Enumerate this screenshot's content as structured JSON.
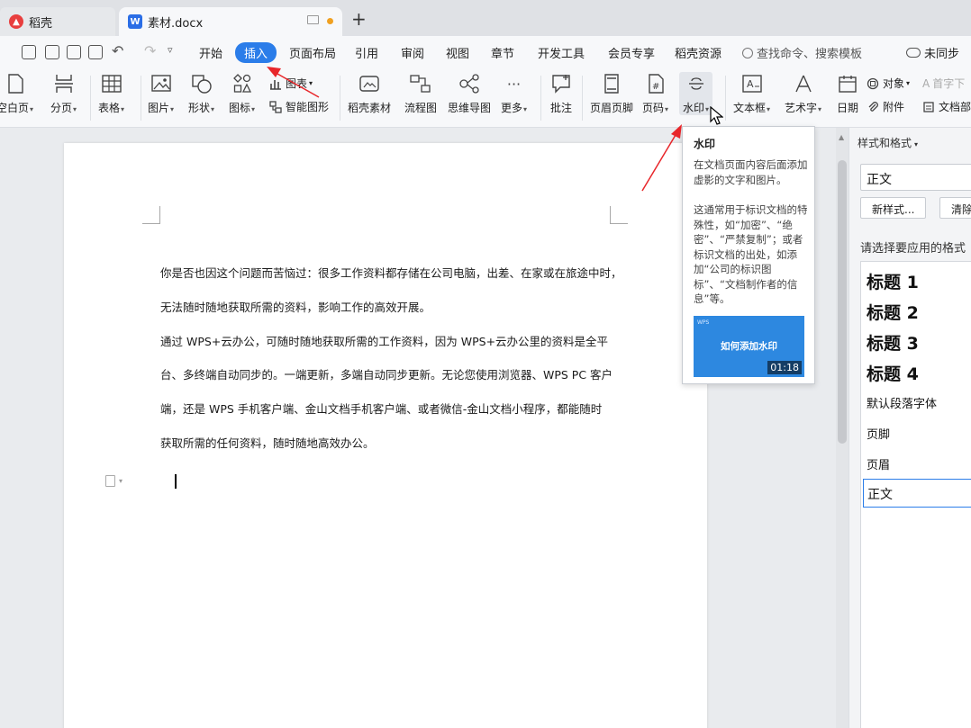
{
  "tabs": [
    {
      "label": "稻壳"
    },
    {
      "label": "素材.docx"
    }
  ],
  "menu": {
    "items": [
      "开始",
      "插入",
      "页面布局",
      "引用",
      "审阅",
      "视图",
      "章节",
      "开发工具",
      "会员专享",
      "稻壳资源"
    ],
    "search": "查找命令、搜索模板",
    "sync": "未同步"
  },
  "ribbon": {
    "blank_page": "空白页",
    "page_break": "分页",
    "table": "表格",
    "picture": "图片",
    "shape": "形状",
    "icon": "图标",
    "chart": "图表",
    "smart_graphic": "智能图形",
    "daoke_material": "稻壳素材",
    "flowchart": "流程图",
    "mindmap": "思维导图",
    "more": "更多",
    "comment": "批注",
    "header_footer": "页眉页脚",
    "page_number": "页码",
    "watermark": "水印",
    "textbox": "文本框",
    "wordart": "艺术字",
    "date": "日期",
    "object": "对象",
    "attachment": "附件",
    "dropcap": "首字下",
    "docpart": "文档部"
  },
  "document": {
    "paragraphs": [
      "你是否也因这个问题而苦恼过：很多工作资料都存储在公司电脑，出差、在家或在旅途中时，",
      "无法随时随地获取所需的资料，影响工作的高效开展。",
      "通过 WPS+云办公，可随时随地获取所需的工作资料，因为 WPS+云办公里的资料是全平",
      "台、多终端自动同步的。一端更新，多端自动同步更新。无论您使用浏览器、WPS PC 客户",
      "端，还是 WPS 手机客户端、金山文档手机客户端、或者微信-金山文档小程序，都能随时",
      "获取所需的任何资料，随时随地高效办公。"
    ]
  },
  "tooltip": {
    "title": "水印",
    "line1": "在文档页面内容后面添加虚影的文字和图片。",
    "line2": "这通常用于标识文档的特殊性，如“加密”、“绝密”、“严禁复制”；或者标识文档的出处，如添加“公司的标识图标”、“文档制作者的信息”等。",
    "video_title": "如何添加水印",
    "video_duration": "01:18"
  },
  "right_pane": {
    "title": "样式和格式",
    "current_style": "正文",
    "new_style_button": "新样式...",
    "clear_button": "清除",
    "choose_label": "请选择要应用的格式",
    "styles": [
      "标题 1",
      "标题 2",
      "标题 3",
      "标题 4",
      "默认段落字体",
      "页脚",
      "页眉",
      "正文"
    ]
  },
  "colors": {
    "accent": "#2b7de9",
    "arrow": "#e8262a"
  }
}
